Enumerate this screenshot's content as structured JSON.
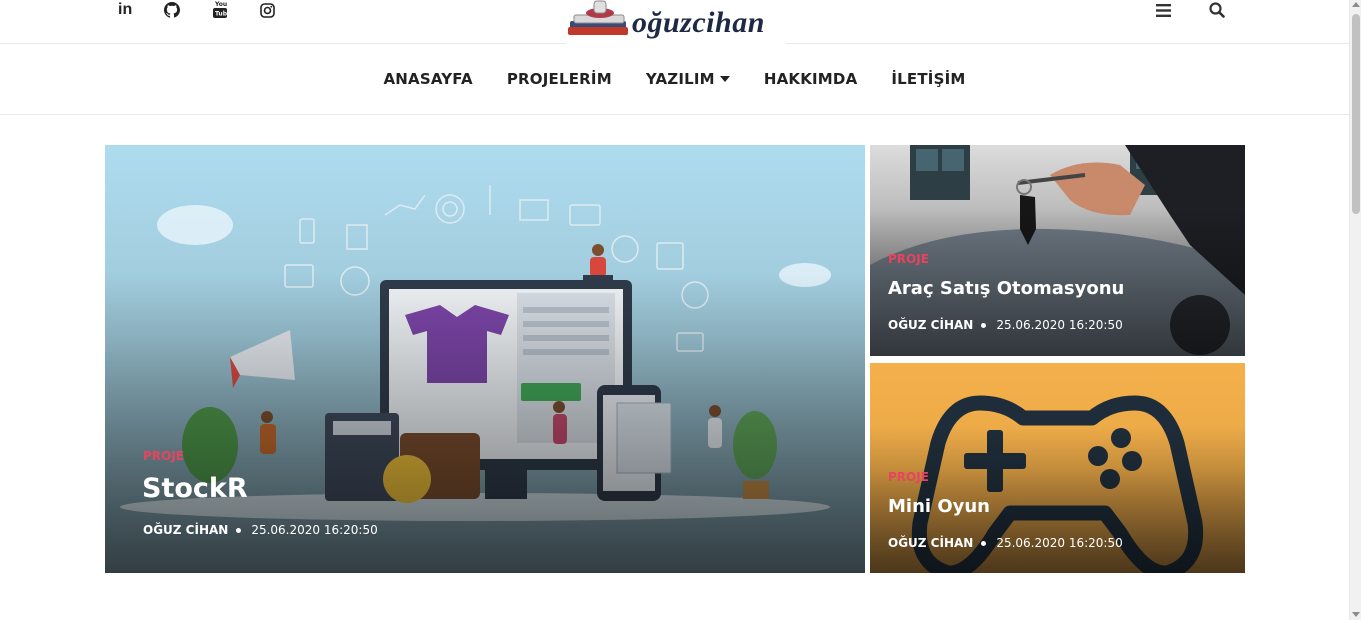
{
  "social": {
    "linkedin_label": "in",
    "icons": [
      "linkedin-icon",
      "github-icon",
      "youtube-icon",
      "instagram-icon"
    ]
  },
  "logo": {
    "text": "oğuzcihan"
  },
  "nav": {
    "items": [
      "ANASAYFA",
      "PROJELERİM",
      "YAZILIM",
      "HAKKIMDA",
      "İLETİŞİM"
    ]
  },
  "top_right": {
    "icons": [
      "menu-icon",
      "search-icon"
    ]
  },
  "posts": [
    {
      "category": "PROJE",
      "title": "StockR",
      "author": "OĞUZ CİHAN",
      "date": "25.06.2020 16:20:50"
    },
    {
      "category": "PROJE",
      "title": "Araç Satış Otomasyonu",
      "author": "OĞUZ CİHAN",
      "date": "25.06.2020 16:20:50"
    },
    {
      "category": "PROJE",
      "title": "Mini Oyun",
      "author": "OĞUZ CİHAN",
      "date": "25.06.2020 16:20:50"
    }
  ],
  "colors": {
    "accent": "#e8435f",
    "text": "#222222",
    "logo": "#1e2a44"
  }
}
